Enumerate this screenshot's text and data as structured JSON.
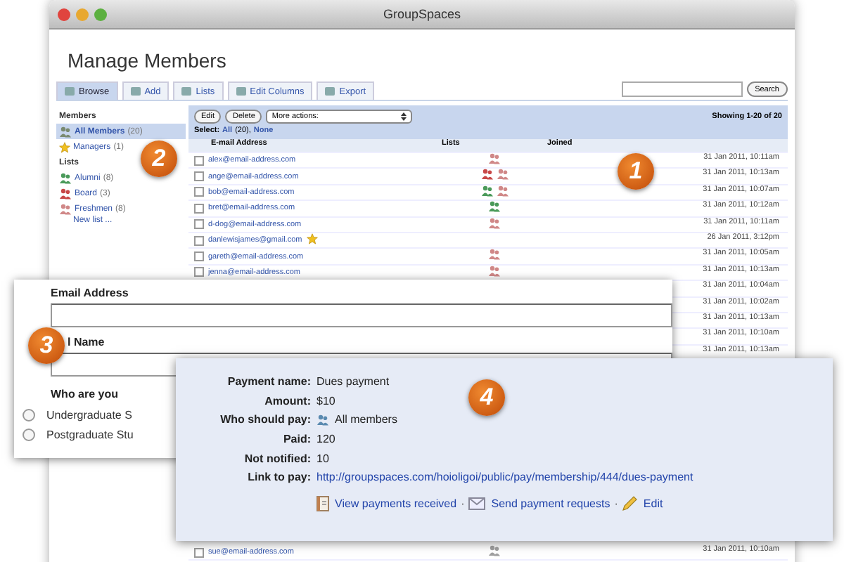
{
  "window": {
    "title": "GroupSpaces"
  },
  "page_title": "Manage Members",
  "tabs": [
    {
      "label": "Browse",
      "selected": true
    },
    {
      "label": "Add",
      "selected": false
    },
    {
      "label": "Lists",
      "selected": false
    },
    {
      "label": "Edit Columns",
      "selected": false
    },
    {
      "label": "Export",
      "selected": false
    }
  ],
  "search": {
    "button": "Search"
  },
  "sidebar": {
    "members_heading": "Members",
    "members": [
      {
        "label": "All Members",
        "count": "(20)",
        "selected": true,
        "kind": "group"
      },
      {
        "label": "Managers",
        "count": "(1)",
        "selected": false,
        "kind": "star"
      }
    ],
    "lists_heading": "Lists",
    "lists": [
      {
        "label": "Alumni",
        "count": "(8)",
        "color": "#4a9a5a"
      },
      {
        "label": "Board",
        "count": "(3)",
        "color": "#c84848"
      },
      {
        "label": "Freshmen",
        "count": "(8)",
        "color": "#d08888"
      }
    ],
    "new_list": "New list ..."
  },
  "toolbar": {
    "buttons": [
      "Edit",
      "Delete"
    ],
    "actions_select": "More actions:",
    "showing": "Showing 1-20 of 20",
    "select_label": "Select:",
    "select_all": "All",
    "select_count": "(20),",
    "select_none": "None"
  },
  "table": {
    "columns": [
      "E-mail Address",
      "Lists",
      "Joined"
    ],
    "rows": [
      {
        "email": "alex@email-address.com",
        "checked": false,
        "starred": false,
        "lists": [
          {
            "color": "#d08888"
          }
        ],
        "joined": "31 Jan 2011, 10:11am"
      },
      {
        "email": "ange@email-address.com",
        "checked": false,
        "starred": false,
        "lists": [
          {
            "color": "#c84848"
          },
          {
            "color": "#d08888"
          }
        ],
        "joined": "31 Jan 2011, 10:13am"
      },
      {
        "email": "bob@email-address.com",
        "checked": false,
        "starred": false,
        "lists": [
          {
            "color": "#4a9a5a"
          },
          {
            "color": "#d08888"
          }
        ],
        "joined": "31 Jan 2011, 10:07am"
      },
      {
        "email": "bret@email-address.com",
        "checked": false,
        "starred": false,
        "lists": [
          {
            "color": "#4a9a5a"
          }
        ],
        "joined": "31 Jan 2011, 10:12am"
      },
      {
        "email": "d-dog@email-address.com",
        "checked": false,
        "starred": false,
        "lists": [
          {
            "color": "#d08888"
          }
        ],
        "joined": "31 Jan 2011, 10:11am"
      },
      {
        "email": "danlewisjames@gmail.com",
        "checked": false,
        "starred": true,
        "lists": [],
        "joined": "26 Jan 2011, 3:12pm"
      },
      {
        "email": "gareth@email-address.com",
        "checked": false,
        "starred": false,
        "lists": [
          {
            "color": "#d08888"
          }
        ],
        "joined": "31 Jan 2011, 10:05am"
      },
      {
        "email": "jenna@email-address.com",
        "checked": false,
        "starred": false,
        "lists": [
          {
            "color": "#d08888"
          }
        ],
        "joined": "31 Jan 2011, 10:13am"
      },
      {
        "joined": "31 Jan 2011, 10:04am"
      },
      {
        "joined": "31 Jan 2011, 10:02am"
      },
      {
        "joined": "31 Jan 2011, 10:13am"
      },
      {
        "joined": "31 Jan 2011, 10:10am"
      },
      {
        "joined": "31 Jan 2011, 10:13am"
      }
    ],
    "rows_below": [
      {
        "email": "sue@email-address.com",
        "checked": false,
        "starred": false,
        "lists": [
          {
            "color": "#a0a0a0"
          }
        ],
        "joined": "31 Jan 2011, 10:10am"
      }
    ]
  },
  "signup_form": {
    "fields": [
      {
        "label": "Email Address"
      },
      {
        "label": "l Name"
      }
    ],
    "question": "Who are you",
    "options": [
      {
        "label": "Undergraduate S",
        "selected": false
      },
      {
        "label": "Postgraduate Stu",
        "selected": false
      }
    ]
  },
  "payment": {
    "details": [
      {
        "label": "Payment name:",
        "value": "Dues payment",
        "kind": "text"
      },
      {
        "label": "Amount:",
        "value": "$10",
        "kind": "text"
      },
      {
        "label": "Who should pay:",
        "value": "All members",
        "kind": "group"
      },
      {
        "label": "Paid:",
        "value": "120",
        "kind": "text"
      },
      {
        "label": "Not notified:",
        "value": "10",
        "kind": "text"
      },
      {
        "label": "Link to pay:",
        "value": "http://groupspaces.com/hoioligoi/public/pay/membership/444/dues-payment",
        "kind": "link"
      }
    ],
    "actions": [
      {
        "label": "View payments received",
        "kind": "document"
      },
      {
        "label": "Send payment requests",
        "kind": "envelope"
      },
      {
        "label": "Edit",
        "kind": "pencil"
      }
    ],
    "separator": "·"
  },
  "callouts": [
    {
      "label": "1"
    },
    {
      "label": "2"
    },
    {
      "label": "3"
    },
    {
      "label": "4"
    }
  ]
}
